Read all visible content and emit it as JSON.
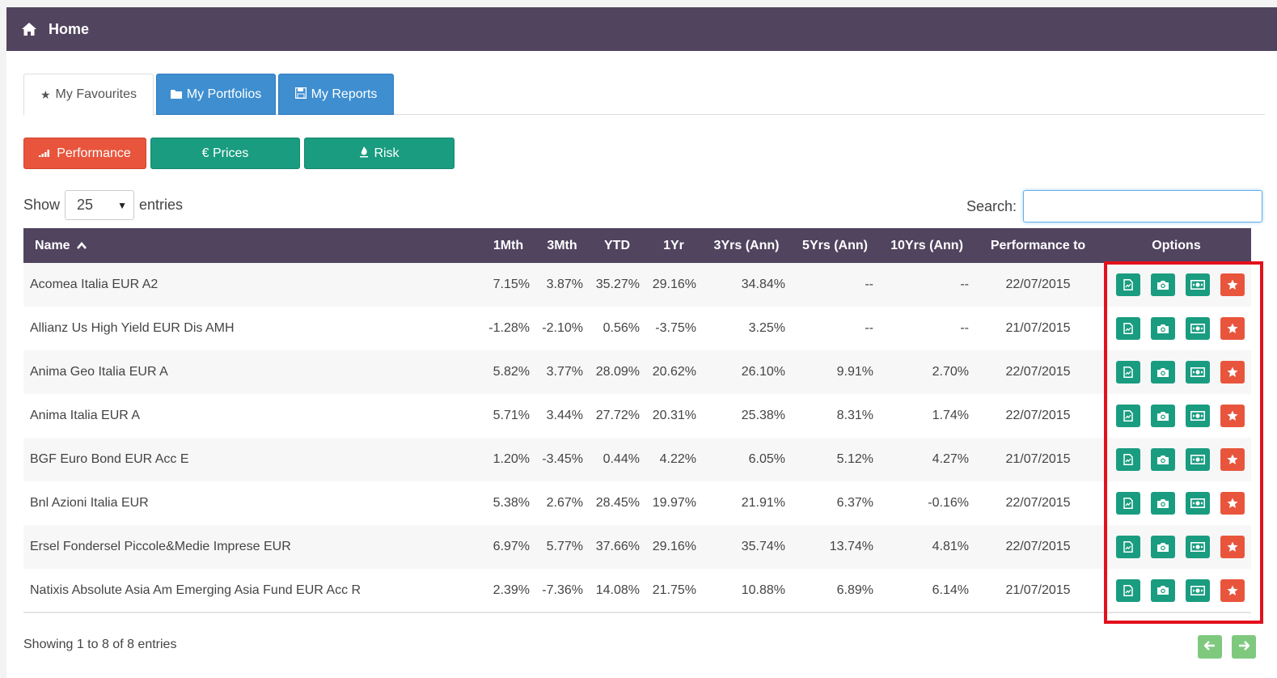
{
  "header": {
    "title": "Home",
    "icon": "home-icon"
  },
  "tabs": [
    {
      "label": "My Favourites",
      "icon": "star-icon",
      "active": true
    },
    {
      "label": "My Portfolios",
      "icon": "folder-icon",
      "active": false
    },
    {
      "label": "My Reports",
      "icon": "save-icon",
      "active": false
    }
  ],
  "view_buttons": {
    "performance": "Performance",
    "prices": "€ Prices",
    "risk": "Risk"
  },
  "length": {
    "show": "Show",
    "value": "25",
    "entries": "entries"
  },
  "search": {
    "label": "Search:",
    "value": ""
  },
  "table": {
    "columns": [
      "Name",
      "1Mth",
      "3Mth",
      "YTD",
      "1Yr",
      "3Yrs (Ann)",
      "5Yrs (Ann)",
      "10Yrs (Ann)",
      "Performance to",
      "Options"
    ],
    "rows": [
      [
        "Acomea Italia EUR A2",
        "7.15%",
        "3.87%",
        "35.27%",
        "29.16%",
        "34.84%",
        "--",
        "--",
        "22/07/2015"
      ],
      [
        "Allianz Us High Yield EUR Dis AMH",
        "-1.28%",
        "-2.10%",
        "0.56%",
        "-3.75%",
        "3.25%",
        "--",
        "--",
        "21/07/2015"
      ],
      [
        "Anima Geo Italia EUR A",
        "5.82%",
        "3.77%",
        "28.09%",
        "20.62%",
        "26.10%",
        "9.91%",
        "2.70%",
        "22/07/2015"
      ],
      [
        "Anima Italia EUR A",
        "5.71%",
        "3.44%",
        "27.72%",
        "20.31%",
        "25.38%",
        "8.31%",
        "1.74%",
        "22/07/2015"
      ],
      [
        "BGF Euro Bond EUR Acc E",
        "1.20%",
        "-3.45%",
        "0.44%",
        "4.22%",
        "6.05%",
        "5.12%",
        "4.27%",
        "21/07/2015"
      ],
      [
        "Bnl Azioni Italia EUR",
        "5.38%",
        "2.67%",
        "28.45%",
        "19.97%",
        "21.91%",
        "6.37%",
        "-0.16%",
        "22/07/2015"
      ],
      [
        "Ersel Fondersel Piccole&Medie Imprese EUR",
        "6.97%",
        "5.77%",
        "37.66%",
        "29.16%",
        "35.74%",
        "13.74%",
        "4.81%",
        "22/07/2015"
      ],
      [
        "Natixis Absolute Asia Am Emerging Asia Fund EUR Acc R",
        "2.39%",
        "-7.36%",
        "14.08%",
        "21.75%",
        "10.88%",
        "6.89%",
        "6.14%",
        "21/07/2015"
      ]
    ],
    "option_icons": [
      "report-icon",
      "camera-icon",
      "money-icon",
      "star-icon"
    ]
  },
  "footer": {
    "info": "Showing 1 to 8 of 8 entries"
  },
  "colors": {
    "header": "#51445f",
    "green": "#1a9c80",
    "orange": "#e8553c",
    "blue": "#3e8ed0",
    "highlight": "#e3101d"
  }
}
